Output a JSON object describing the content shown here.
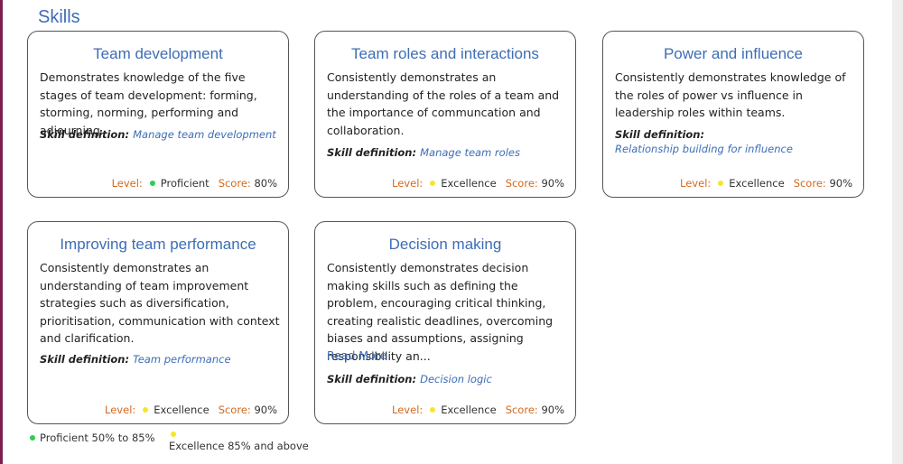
{
  "section": {
    "heading": "Skills"
  },
  "labels": {
    "level": "Level:",
    "score": "Score:",
    "skill_definition": "Skill definition:"
  },
  "colors": {
    "proficient": "#2ecc55",
    "excellence": "#f5e62a",
    "link": "#3d6db5",
    "label": "#d2691e"
  },
  "cards": [
    {
      "title": "Team development",
      "description": "Demonstrates knowledge of the five stages of team development: forming, storming, norming, performing and adjourning.",
      "definition_link": "Manage team development",
      "level": "Proficient",
      "level_color": "#2ecc55",
      "score": "80%"
    },
    {
      "title": "Team roles and interactions",
      "description": "Consistently demonstrates an understanding of the roles of a team and the importance of communcation and collaboration.",
      "definition_link": "Manage team roles",
      "level": "Excellence",
      "level_color": "#f5e62a",
      "score": "90%"
    },
    {
      "title": "Power and influence",
      "description": "Consistently demonstrates knowledge of the roles of power vs influence in leadership roles within teams.",
      "definition_link": "Relationship building for influence",
      "level": "Excellence",
      "level_color": "#f5e62a",
      "score": "90%"
    },
    {
      "title": "Improving team performance",
      "description": "Consistently demonstrates an understanding of team improvement strategies such as diversification, prioritisation, communication with context and clarification.",
      "definition_link": "Team performance",
      "level": "Excellence",
      "level_color": "#f5e62a",
      "score": "90%"
    },
    {
      "title": "Decision making",
      "description": "Consistently demonstrates decision making skills such as defining the problem, encouraging critical thinking, creating realistic deadlines, overcoming biases and assumptions, assigning responsibility an...",
      "read_more": "Read More",
      "definition_link": "Decision logic",
      "level": "Excellence",
      "level_color": "#f5e62a",
      "score": "90%"
    }
  ],
  "legend": [
    {
      "text": "Proficient 50% to 85%",
      "color": "#2ecc55"
    },
    {
      "text": "Excellence 85% and above",
      "color": "#f5e62a"
    }
  ]
}
